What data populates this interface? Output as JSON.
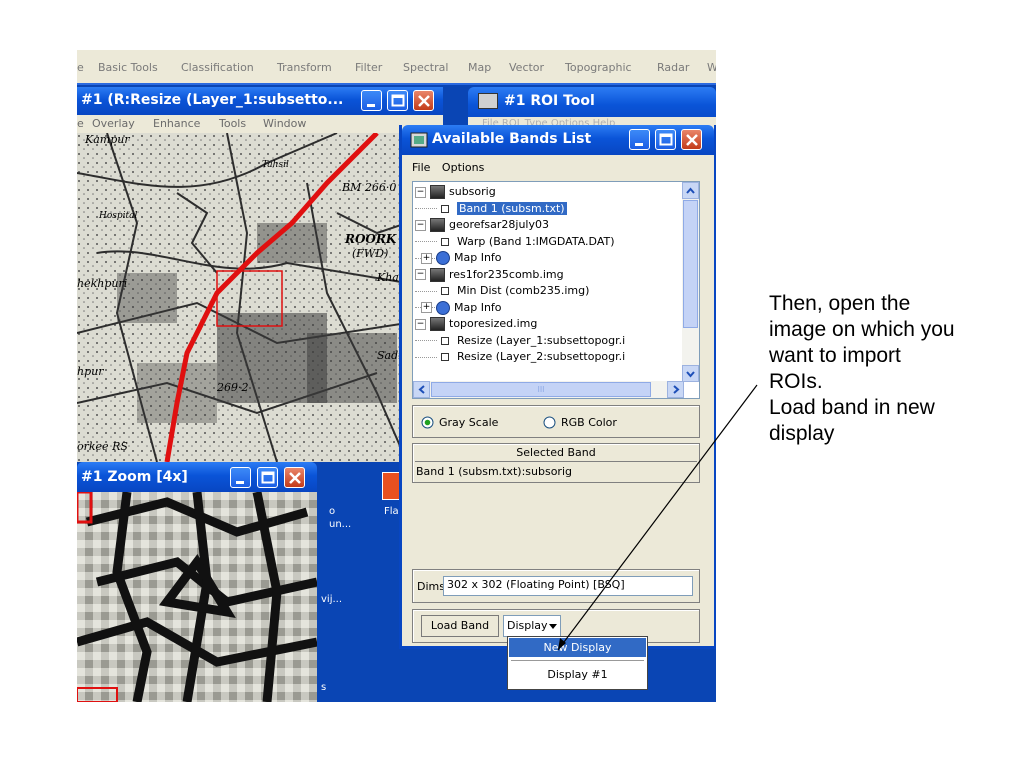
{
  "app_menu": [
    "e",
    "Basic Tools",
    "Classification",
    "Transform",
    "Filter",
    "Spectral",
    "Map",
    "Vector",
    "Topographic",
    "Radar",
    "W"
  ],
  "image_window": {
    "title": "#1 (R:Resize (Layer_1:subsetto...",
    "menu": [
      "e",
      "Overlay",
      "Enhance",
      "Tools",
      "Window"
    ],
    "map_labels": [
      "Kampur",
      "BM 266·0",
      "ROORK",
      "(FWD)",
      "Khat",
      "hekhpuri",
      "hpur",
      "269·2",
      "orkee RS",
      "Sadium",
      "Hospital",
      "Tahsil"
    ]
  },
  "zoom_window": {
    "title": "#1 Zoom [4x]"
  },
  "roi_tool": {
    "title": "#1 ROI Tool",
    "menu_ghost": "File  ROI_Type  Options  Help"
  },
  "bands_window": {
    "title": "Available Bands List",
    "menu": [
      "File",
      "Options"
    ],
    "tree": [
      {
        "label": "subsorig",
        "level": 0,
        "toggle": "−"
      },
      {
        "label": "Band 1 (subsm.txt)",
        "level": 1,
        "selected": true
      },
      {
        "label": "georefsar28july03",
        "level": 0,
        "toggle": "−"
      },
      {
        "label": "Warp (Band 1:IMGDATA.DAT)",
        "level": 1
      },
      {
        "label": "Map Info",
        "level": 1,
        "toggle": "+"
      },
      {
        "label": "res1for235comb.img",
        "level": 0,
        "toggle": "−"
      },
      {
        "label": "Min Dist (comb235.img)",
        "level": 1
      },
      {
        "label": "Map Info",
        "level": 1,
        "toggle": "+"
      },
      {
        "label": "toporesized.img",
        "level": 0,
        "toggle": "−"
      },
      {
        "label": "Resize (Layer_1:subsettopogr.i",
        "level": 1
      },
      {
        "label": "Resize (Layer_2:subsettopogr.i",
        "level": 1
      }
    ],
    "scroll_mid": "III",
    "gray_scale": "Gray Scale",
    "rgb_color": "RGB Color",
    "selected_band_heading": "Selected Band",
    "selected_band_value": "Band 1 (subsm.txt):subsorig",
    "dims_label": "Dims",
    "dims_value": "302 x 302 (Floating Point) [BSQ]",
    "load_band": "Load Band",
    "display_select": "Display #1",
    "dropdown": [
      "New Display",
      "Display #1"
    ]
  },
  "desktop_icons": [
    "o",
    "un...",
    "Flas",
    "vij...",
    "s"
  ],
  "caption": [
    "Then, open the",
    "image on which you",
    "want to import",
    "ROIs.",
    "Load band in new",
    "display"
  ],
  "colors": {
    "xp_blue": "#0a54d8",
    "desktop": "#0a45b4",
    "selection": "#316ac5",
    "roi_red": "#e01010"
  }
}
